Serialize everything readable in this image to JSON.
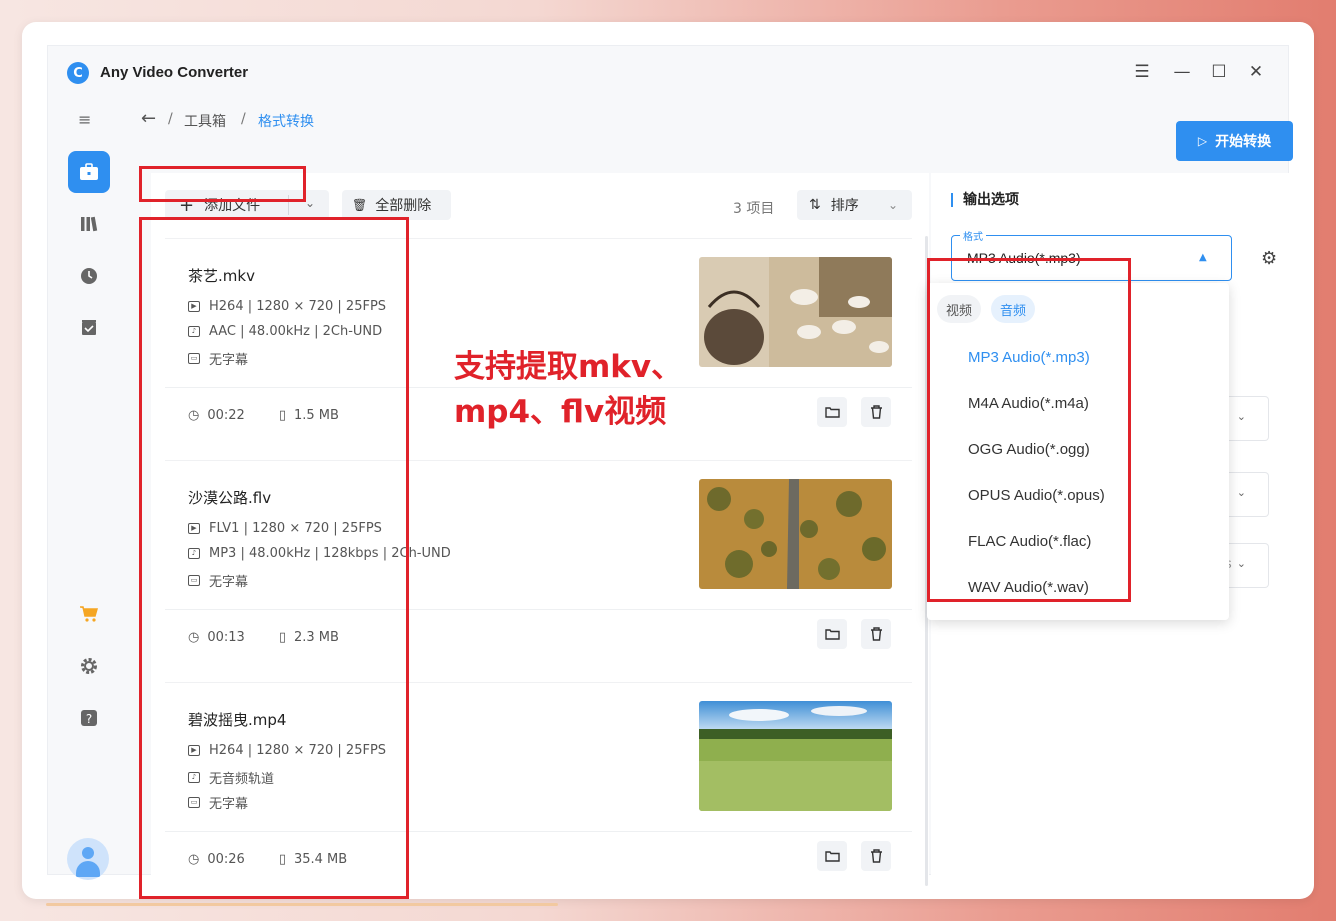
{
  "app": {
    "title": "Any Video Converter",
    "logo": "C"
  },
  "window_controls": {
    "menu": "☰",
    "minimize": "—",
    "maximize": "☐",
    "close": "✕"
  },
  "breadcrumb": {
    "back": "←",
    "sep1": "/",
    "parent": "工具箱",
    "sep2": "/",
    "current": "格式转换"
  },
  "start_button": {
    "icon": "▷",
    "label": "开始转换"
  },
  "sidebar": {
    "collapse_icon": "≡",
    "icons": [
      "toolbox-icon",
      "library-icon",
      "history-icon",
      "tasks-icon",
      "cart-icon",
      "settings-icon",
      "help-icon",
      "avatar"
    ]
  },
  "toolbar": {
    "add_label": "添加文件",
    "add_icon": "+",
    "add_chevron": "⌄",
    "delete_icon": "🗑",
    "delete_label": "全部删除",
    "count": "3 项目",
    "sort_icon": "⇅",
    "sort_label": "排序",
    "sort_chevron": "⌄"
  },
  "files": [
    {
      "name": "茶艺.mkv",
      "video": "H264 | 1280 × 720 | 25FPS",
      "audio": "AAC | 48.00kHz | 2Ch-UND",
      "subtitle": "无字幕",
      "duration": "00:22",
      "size": "1.5 MB"
    },
    {
      "name": "沙漠公路.flv",
      "video": "FLV1 | 1280 × 720 | 25FPS",
      "audio": "MP3 | 48.00kHz | 128kbps | 2Ch-UND",
      "subtitle": "无字幕",
      "duration": "00:13",
      "size": "2.3 MB"
    },
    {
      "name": "碧波摇曳.mp4",
      "video": "H264 | 1280 × 720 | 25FPS",
      "audio": "无音频轨道",
      "subtitle": "无字幕",
      "duration": "00:26",
      "size": "35.4 MB"
    }
  ],
  "annotation": {
    "line1": "支持提取mkv、",
    "line2": "mp4、flv视频"
  },
  "output": {
    "title": "输出选项",
    "format_label": "格式",
    "format_value": "MP3 Audio(*.mp3)",
    "caret": "▲",
    "settings_icon": "⚙",
    "ghost_tail": "os",
    "chevron": "⌄"
  },
  "dropdown": {
    "tabs": [
      {
        "label": "视频",
        "active": false
      },
      {
        "label": "音频",
        "active": true
      }
    ],
    "options": [
      "MP3 Audio(*.mp3)",
      "M4A Audio(*.m4a)",
      "OGG Audio(*.ogg)",
      "OPUS Audio(*.opus)",
      "FLAC Audio(*.flac)",
      "WAV Audio(*.wav)"
    ],
    "selected": "MP3 Audio(*.mp3)"
  },
  "colors": {
    "accent": "#2f8ff0",
    "highlight_red": "#e0222a"
  }
}
